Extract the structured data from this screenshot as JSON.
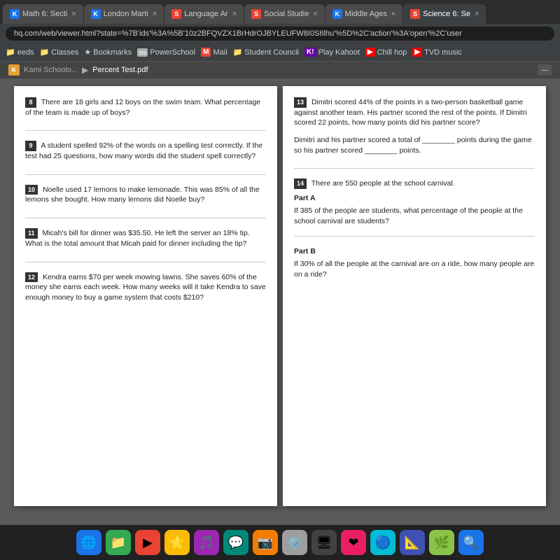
{
  "browser": {
    "tabs": [
      {
        "id": "tab1",
        "label": "Math 6: Secti",
        "favicon_type": "k",
        "favicon_letter": "K",
        "active": false
      },
      {
        "id": "tab2",
        "label": "London Marti",
        "favicon_type": "k",
        "favicon_letter": "K",
        "active": false
      },
      {
        "id": "tab3",
        "label": "Language Ar",
        "favicon_type": "s",
        "favicon_letter": "S",
        "active": false
      },
      {
        "id": "tab4",
        "label": "Social Studie",
        "favicon_type": "s",
        "favicon_letter": "S",
        "active": false
      },
      {
        "id": "tab5",
        "label": "Middle Ages",
        "favicon_type": "k",
        "favicon_letter": "K",
        "active": false
      },
      {
        "id": "tab6",
        "label": "Science 6: Se",
        "favicon_type": "s",
        "favicon_letter": "S",
        "active": true
      }
    ],
    "address_bar_text": "hq.com/web/viewer.html?state=%7B'ids'%3A%5B'10z2BFQVZX1BrHdrOJBYLEUFW8I0S6lhu'%5D%2C'action'%3A'open'%2C'user",
    "bookmarks": [
      {
        "label": "eeds",
        "icon": "folder"
      },
      {
        "label": "Classes",
        "icon": "folder"
      },
      {
        "label": "Bookmarks",
        "icon": "star"
      },
      {
        "label": "PowerSchool",
        "icon": "sis"
      },
      {
        "label": "Mail",
        "icon": "m"
      },
      {
        "label": "Student Council",
        "icon": "folder"
      },
      {
        "label": "Play Kahoot",
        "icon": "k"
      },
      {
        "label": "Chill hop",
        "icon": "youtube"
      },
      {
        "label": "TVD music",
        "icon": "youtube"
      }
    ]
  },
  "kami_bar": {
    "breadcrumb_root": "Kami Schoolo...",
    "breadcrumb_separator": "▶",
    "breadcrumb_file": "Percent Test.pdf"
  },
  "document": {
    "left_column": {
      "questions": [
        {
          "num": "8",
          "text": "There are 18 girls and 12 boys on the swim team. What percentage of the team is made up of boys?"
        },
        {
          "num": "9",
          "text": "A student spelled 92% of the words on a spelling test correctly. If the test had 25 questions, how many words did the student spell correctly?"
        },
        {
          "num": "10",
          "text": "Noelle used 17 lemons to make lemonade. This was 85% of all the lemons she bought. How many lemons did Noelle buy?"
        },
        {
          "num": "11",
          "text": "Micah's bill for dinner was $35.50. He left the server an 18% tip. What is the total amount that Micah paid for dinner including the tip?"
        },
        {
          "num": "12",
          "text": "Kendra earns $70 per week mowing lawns. She saves 60% of the money she earns each week. How many weeks will it take Kendra to save enough money to buy a game system that costs $210?"
        }
      ]
    },
    "right_column": {
      "questions": [
        {
          "num": "13",
          "text": "Dimitri scored 44% of the points in a two-person basketball game against another team. His partner scored the rest of the points. If Dimitri scored 22 points, how many points did his partner score?",
          "extra_text": "Dimitri and his partner scored a total of ________ points during the game so his partner scored ________ points."
        },
        {
          "num": "14",
          "text": "There are 550 people at the school carnival.",
          "parts": [
            {
              "label": "Part A",
              "text": "If 385 of the people are students, what percentage of the people at the school carnival are students?"
            },
            {
              "label": "Part B",
              "text": "If 30% of all the people at the carnival are on a ride, how many people are on a ride?"
            }
          ]
        }
      ]
    }
  },
  "dock": {
    "icons": [
      {
        "color": "blue",
        "symbol": "🌐"
      },
      {
        "color": "green",
        "symbol": "📁"
      },
      {
        "color": "red",
        "symbol": "▶"
      },
      {
        "color": "yellow",
        "symbol": "⭐"
      },
      {
        "color": "purple",
        "symbol": "🎵"
      },
      {
        "color": "teal",
        "symbol": "💬"
      },
      {
        "color": "orange",
        "symbol": "📷"
      },
      {
        "color": "gray",
        "symbol": "⚙️"
      },
      {
        "color": "dark",
        "symbol": "🖥"
      },
      {
        "color": "pink",
        "symbol": "❤"
      },
      {
        "color": "cyan",
        "symbol": "🔵"
      },
      {
        "color": "indigo",
        "symbol": "📐"
      },
      {
        "color": "lime",
        "symbol": "🌿"
      },
      {
        "color": "blue",
        "symbol": "🔍"
      }
    ]
  }
}
